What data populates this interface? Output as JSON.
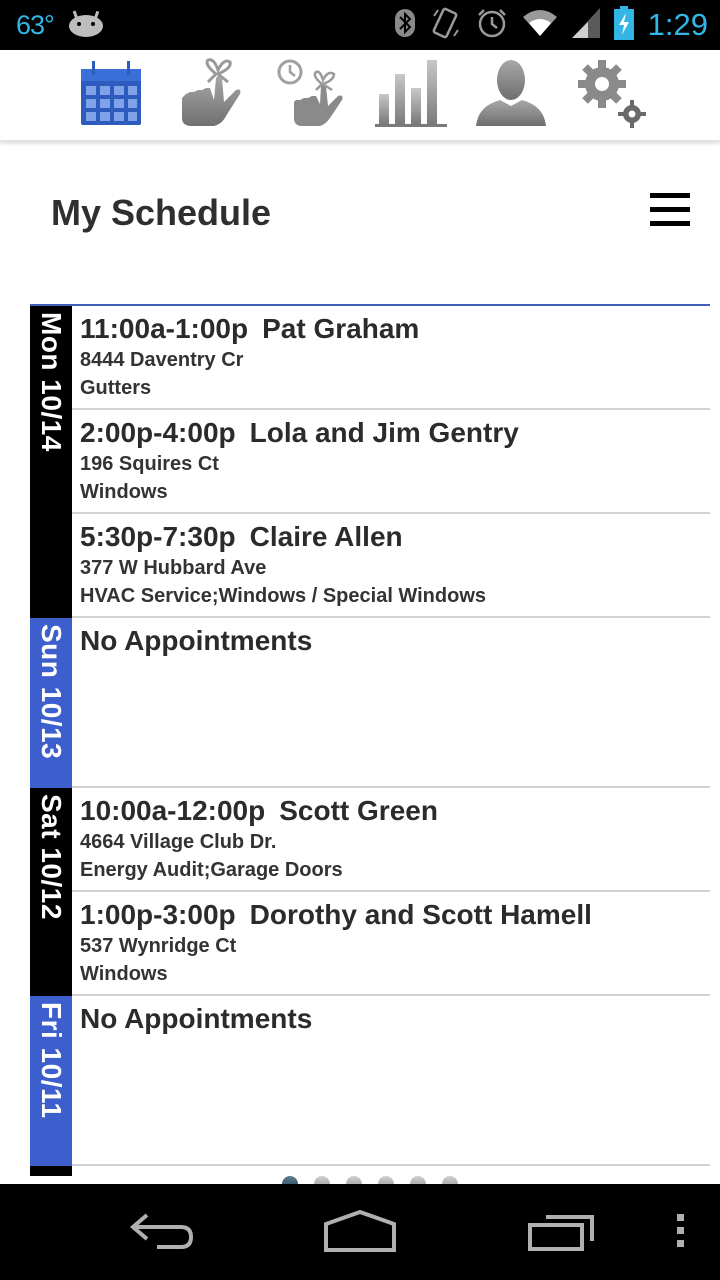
{
  "status_bar": {
    "temperature": "63°",
    "time": "1:29",
    "icons": [
      "android-icon",
      "bluetooth-icon",
      "auto-rotate-icon",
      "alarm-icon",
      "wifi-icon",
      "signal-icon",
      "battery-charging-icon"
    ]
  },
  "toolbar": {
    "items": [
      {
        "name": "calendar",
        "icon": "calendar-icon",
        "active": true
      },
      {
        "name": "reminders",
        "icon": "finger-ribbon-icon",
        "active": false
      },
      {
        "name": "timed-reminders",
        "icon": "clock-finger-ribbon-icon",
        "active": false
      },
      {
        "name": "reports",
        "icon": "bar-chart-icon",
        "active": false
      },
      {
        "name": "profile",
        "icon": "person-icon",
        "active": false
      },
      {
        "name": "settings",
        "icon": "gears-icon",
        "active": false
      }
    ],
    "active_color": "#2e5cbe",
    "inactive_color": "#8a8a8a"
  },
  "header": {
    "title": "My Schedule",
    "menu_icon": "hamburger-menu-icon"
  },
  "schedule": {
    "accent_color": "#3d5fce",
    "days": [
      {
        "label": "Mon 10/14",
        "color": "black",
        "appointments": [
          {
            "time": "11:00a-1:00p",
            "name": "Pat Graham",
            "address": "8444 Daventry Cr",
            "services": "Gutters"
          },
          {
            "time": "2:00p-4:00p",
            "name": "Lola and Jim Gentry",
            "address": "196 Squires Ct",
            "services": "Windows"
          },
          {
            "time": "5:30p-7:30p",
            "name": "Claire Allen",
            "address": "377 W Hubbard Ave",
            "services": "HVAC Service;Windows / Special Windows"
          }
        ]
      },
      {
        "label": "Sun 10/13",
        "color": "blue",
        "empty_text": "No Appointments",
        "appointments": []
      },
      {
        "label": "Sat 10/12",
        "color": "black",
        "appointments": [
          {
            "time": "10:00a-12:00p",
            "name": "Scott Green",
            "address": "4664 Village Club Dr.",
            "services": "Energy Audit;Garage Doors"
          },
          {
            "time": "1:00p-3:00p",
            "name": "Dorothy and Scott Hamell",
            "address": "537 Wynridge Ct",
            "services": "Windows"
          }
        ]
      },
      {
        "label": "Fri 10/11",
        "color": "blue",
        "empty_text": "No Appointments",
        "appointments": []
      }
    ]
  },
  "pager": {
    "count": 6,
    "active_index": 0
  },
  "nav_bar": {
    "buttons": [
      "back-icon",
      "home-icon",
      "recent-apps-icon",
      "overflow-menu-icon"
    ]
  }
}
